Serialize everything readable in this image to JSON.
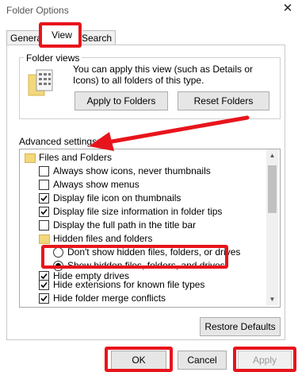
{
  "window": {
    "title": "Folder Options",
    "close_symbol": "✕"
  },
  "tabs": [
    {
      "label": "General"
    },
    {
      "label": "View",
      "selected": true
    },
    {
      "label": "Search"
    }
  ],
  "folder_views": {
    "heading": "Folder views",
    "description": "You can apply this view (such as Details or Icons) to all folders of this type.",
    "apply_button": "Apply to Folders",
    "reset_button": "Reset Folders"
  },
  "advanced": {
    "heading": "Advanced settings:",
    "items": [
      {
        "type": "folder",
        "label": "Files and Folders"
      },
      {
        "type": "checkbox",
        "checked": false,
        "label": "Always show icons, never thumbnails"
      },
      {
        "type": "checkbox",
        "checked": false,
        "label": "Always show menus"
      },
      {
        "type": "checkbox",
        "checked": true,
        "label": "Display file icon on thumbnails"
      },
      {
        "type": "checkbox",
        "checked": true,
        "label": "Display file size information in folder tips"
      },
      {
        "type": "checkbox",
        "checked": false,
        "label": "Display the full path in the title bar"
      },
      {
        "type": "folder",
        "label": "Hidden files and folders"
      },
      {
        "type": "radio",
        "selected": false,
        "label": "Don't show hidden files, folders, or drives"
      },
      {
        "type": "radio",
        "selected": true,
        "label": "Show hidden files, folders, and drives"
      },
      {
        "type": "checkbox",
        "checked": true,
        "label": "Hide empty drives"
      },
      {
        "type": "checkbox",
        "checked": true,
        "label": "Hide extensions for known file types"
      },
      {
        "type": "checkbox",
        "checked": true,
        "label": "Hide folder merge conflicts"
      }
    ],
    "restore_button": "Restore Defaults"
  },
  "footer": {
    "ok": "OK",
    "cancel": "Cancel",
    "apply": "Apply"
  },
  "colors": {
    "highlight": "#e8141c",
    "folder": "#f3d77b"
  }
}
